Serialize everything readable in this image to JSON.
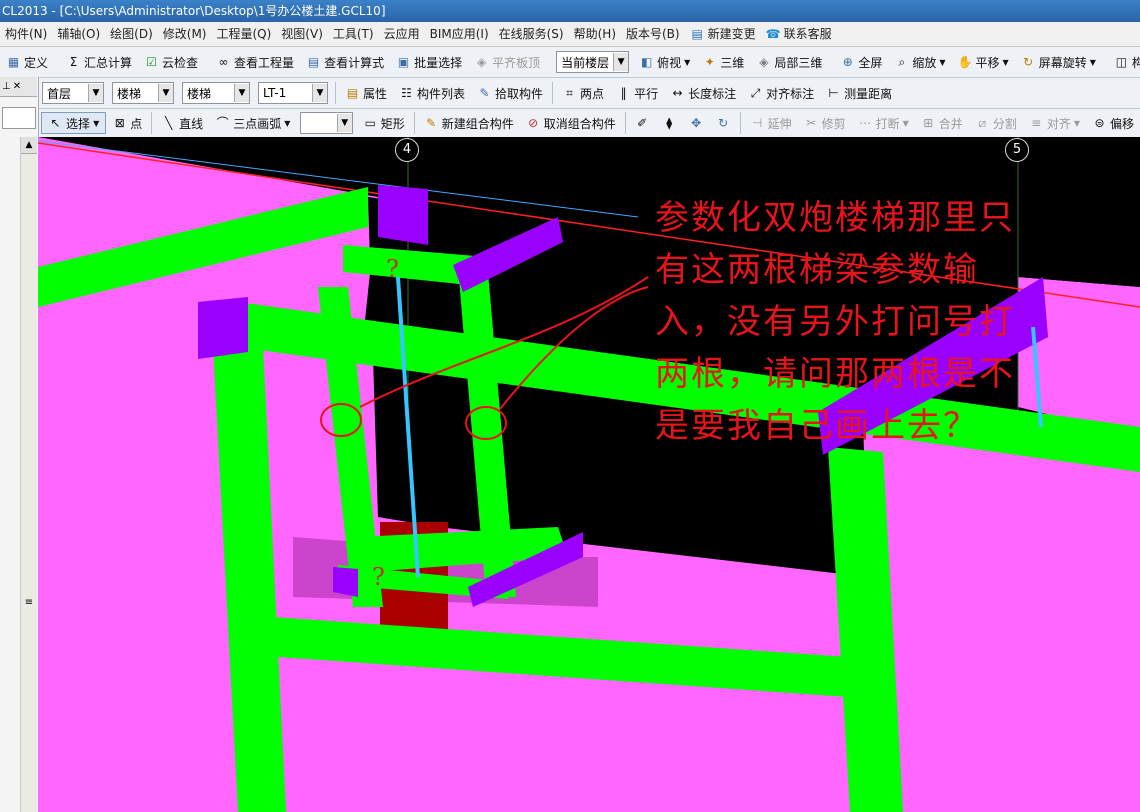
{
  "window": {
    "title": "CL2013 - [C:\\Users\\Administrator\\Desktop\\1号办公楼土建.GCL10]"
  },
  "menu": {
    "items": [
      "构件(N)",
      "辅轴(O)",
      "绘图(D)",
      "修改(M)",
      "工程量(Q)",
      "视图(V)",
      "工具(T)",
      "云应用",
      "BIM应用(I)",
      "在线服务(S)",
      "帮助(H)",
      "版本号(B)"
    ],
    "new_change": "新建变更",
    "contact": "联系客服"
  },
  "toolbar1": {
    "define": "定义",
    "sum_calc": "汇总计算",
    "cloud_check": "云检查",
    "view_quantity": "查看工程量",
    "view_formula": "查看计算式",
    "batch_select": "批量选择",
    "align_slab": "平齐板顶",
    "floor_combo": "当前楼层",
    "top_view": "俯视",
    "three_d": "三维",
    "local_3d": "局部三维",
    "full_screen": "全屏",
    "zoom": "缩放",
    "pan": "平移",
    "rotate": "屏幕旋转",
    "component_tool": "构件图元"
  },
  "toolbar2": {
    "floor": "首层",
    "category": "楼梯",
    "type": "楼梯",
    "component": "LT-1",
    "properties": "属性",
    "component_list": "构件列表",
    "pick_component": "拾取构件",
    "two_point": "两点",
    "parallel": "平行",
    "length_dim": "长度标注",
    "align_dim": "对齐标注",
    "measure": "测量距离"
  },
  "toolbar3": {
    "select": "选择",
    "point": "点",
    "line": "直线",
    "arc": "三点画弧",
    "rect": "矩形",
    "new_group": "新建组合构件",
    "cancel_group": "取消组合构件",
    "extend": "延伸",
    "trim": "修剪",
    "break": "打断",
    "merge": "合并",
    "split": "分割",
    "align": "对齐",
    "offset": "偏移"
  },
  "viewport": {
    "axis_labels": [
      "4",
      "5"
    ],
    "annotation": "参数化双炮楼梯那里只有这两根梯梁参数输入，没有另外打问号打两根，请问那两根是不是要我自己画上去？",
    "question_marks": [
      "?",
      "?"
    ],
    "colors": {
      "background": "#000000",
      "slab": "#ff66ff",
      "beam": "#00ff00",
      "column": "#9900ff",
      "annotation": "#e8141c",
      "stair": "#aa0000"
    }
  }
}
